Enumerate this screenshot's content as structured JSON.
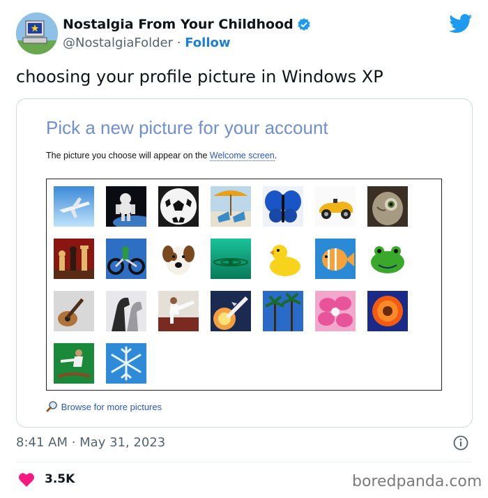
{
  "tweet": {
    "author_name": "Nostalgia From Your Childhood",
    "handle": "@NostalgiaFolder",
    "separator": "·",
    "follow_label": "Follow",
    "text": "choosing your profile picture in Windows XP",
    "timestamp": "8:41 AM · May 31, 2023",
    "likes": "3.5K",
    "verified": true
  },
  "embedded_image": {
    "title": "Pick a new picture for your account",
    "description_prefix": "The picture you choose will appear on the ",
    "description_link": "Welcome screen",
    "description_suffix": ".",
    "browse_label": "Browse for more pictures",
    "pictures": [
      "airplane",
      "astronaut",
      "soccer-ball",
      "beach-chairs",
      "butterfly",
      "race-car",
      "owl",
      "chess",
      "dirt-bike",
      "dog",
      "drip",
      "duck",
      "fish",
      "frog",
      "guitar",
      "horses",
      "karate",
      "airplane-launch",
      "palm-trees",
      "pink-flower",
      "orange-flower",
      "skateboard",
      "snowflake"
    ]
  },
  "watermark": "boredpanda.com",
  "colors": {
    "brand_blue": "#1d9bf0",
    "like_pink": "#f91880",
    "xp_title": "#6f8fd0",
    "xp_link": "#2a58c2"
  },
  "icons": [
    "avatar-computer-icon",
    "verified-badge-icon",
    "twitter-bird-icon",
    "info-icon",
    "heart-icon",
    "magnifier-icon"
  ]
}
